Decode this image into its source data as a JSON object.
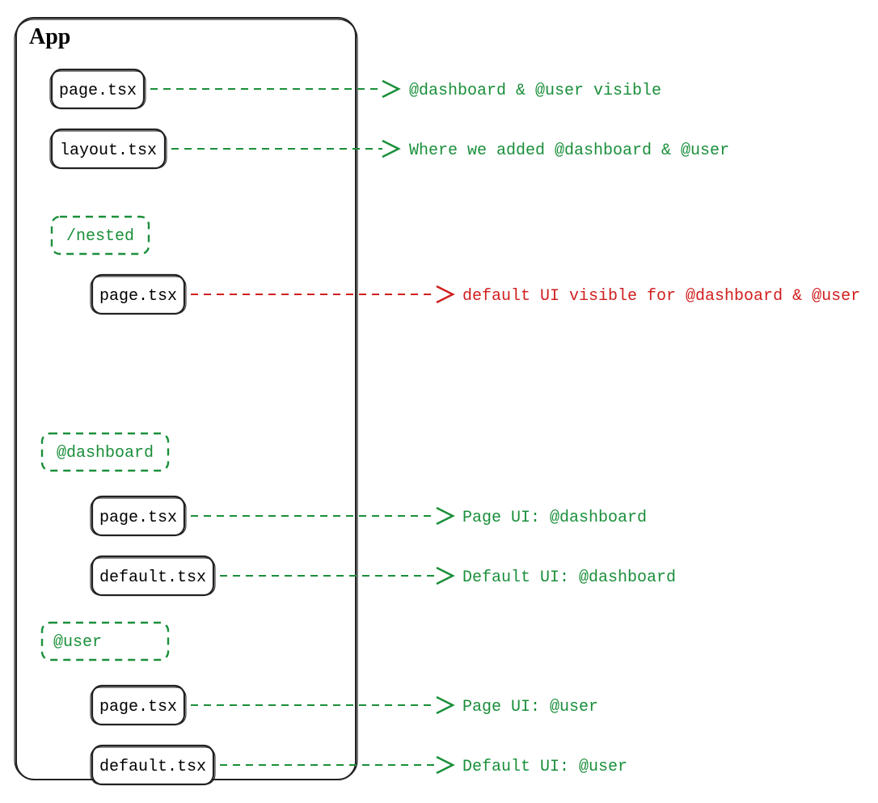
{
  "colors": {
    "stroke": "#222222",
    "green": "#1a8f3a",
    "red": "#d11f1f"
  },
  "container": {
    "title": "App"
  },
  "nodes": {
    "file_page": "page.tsx",
    "file_layout": "layout.tsx",
    "folder_nested": "/nested",
    "nested_page": "page.tsx",
    "folder_dashboard": "@dashboard",
    "dash_page": "page.tsx",
    "dash_default": "default.tsx",
    "folder_user": "@user",
    "user_page": "page.tsx",
    "user_default": "default.tsx"
  },
  "annotations": {
    "file_page": "@dashboard & @user visible",
    "file_layout": "Where we added @dashboard & @user",
    "nested_page": "default UI visible for @dashboard & @user",
    "dash_page": "Page UI: @dashboard",
    "dash_default": "Default UI: @dashboard",
    "user_page": "Page UI: @user",
    "user_default": "Default UI: @user"
  }
}
